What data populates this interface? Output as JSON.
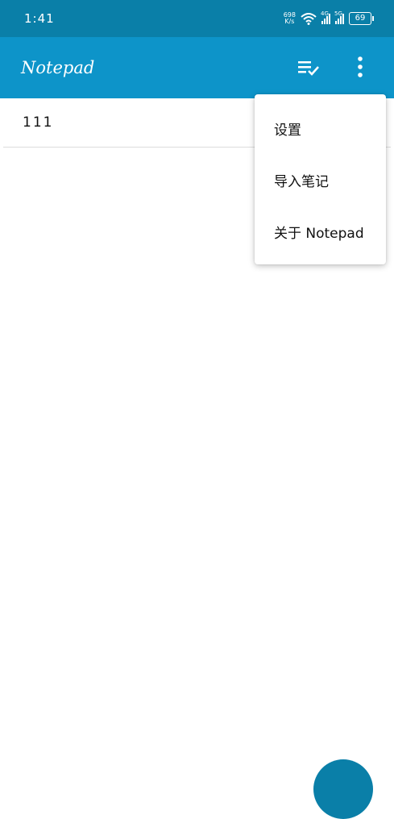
{
  "status_bar": {
    "time": "1:41",
    "net_speed_value": "698",
    "net_speed_unit": "K/s",
    "signal1_label": "4G",
    "signal2_label": "5G",
    "battery": "69"
  },
  "app_bar": {
    "title": "Notepad",
    "sort_icon": "sort-check-icon",
    "more_icon": "more-vert-icon"
  },
  "notes": [
    {
      "title": "111"
    }
  ],
  "menu": {
    "items": [
      {
        "label": "设置"
      },
      {
        "label": "导入笔记"
      },
      {
        "label": "关于 Notepad"
      }
    ]
  },
  "colors": {
    "status_bar": "#0a7fa8",
    "app_bar": "#0d94c9",
    "fab": "#0a7fa8"
  }
}
